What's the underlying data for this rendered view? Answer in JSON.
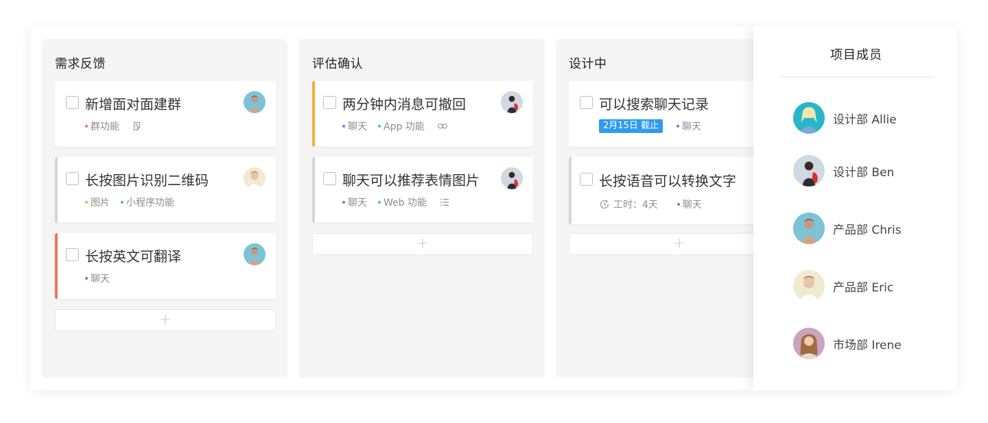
{
  "columns": [
    {
      "title": "需求反馈",
      "cards": [
        {
          "title": "新增面对面建群",
          "tags": [
            {
              "label": "群功能",
              "color": "#f0735f"
            }
          ],
          "icon": "document-icon",
          "avatar": "chris"
        },
        {
          "title": "长按图片识别二维码",
          "tags": [
            {
              "label": "图片",
              "color": "#f7ad3a"
            },
            {
              "label": "小程序功能",
              "color": "#2fc4d8"
            }
          ],
          "avatar": "eric"
        },
        {
          "title": "长按英文可翻译",
          "tags": [
            {
              "label": "聊天",
              "color": "#7f6fe0"
            }
          ],
          "avatar": "chris"
        }
      ],
      "add_label": "+"
    },
    {
      "title": "评估确认",
      "cards": [
        {
          "title": "两分钟内消息可撤回",
          "tags": [
            {
              "label": "聊天",
              "color": "#7f6fe0"
            },
            {
              "label": "App 功能",
              "color": "#2fc4d8"
            }
          ],
          "icon": "link-icon",
          "avatar": "ben"
        },
        {
          "title": "聊天可以推荐表情图片",
          "tags": [
            {
              "label": "聊天",
              "color": "#7f6fe0"
            },
            {
              "label": "Web 功能",
              "color": "#2fc4d8"
            }
          ],
          "icon": "list-icon",
          "avatar": "ben"
        }
      ],
      "add_label": "+"
    },
    {
      "title": "设计中",
      "cards": [
        {
          "title": "可以搜索聊天记录",
          "due": "2月15日 截止",
          "tags": [
            {
              "label": "聊天",
              "color": "#7f6fe0"
            }
          ]
        },
        {
          "title": "长按语音可以转换文字",
          "hours": "工时：4天",
          "tags": [
            {
              "label": "聊天",
              "color": "#7f6fe0"
            }
          ]
        }
      ],
      "add_label": "+"
    }
  ],
  "members_panel": {
    "title": "项目成员",
    "members": [
      {
        "name": "设计部 Allie",
        "avatar": "allie"
      },
      {
        "name": "设计部 Ben",
        "avatar": "ben"
      },
      {
        "name": "产品部 Chris",
        "avatar": "chris"
      },
      {
        "name": "产品部 Eric",
        "avatar": "eric"
      },
      {
        "name": "市场部 Irene",
        "avatar": "irene"
      }
    ]
  },
  "colors": {
    "accent_orange": "#f7ad3a",
    "accent_red": "#f0735f",
    "due_blue": "#2f9bf0",
    "column_bg": "#f5f5f5"
  }
}
